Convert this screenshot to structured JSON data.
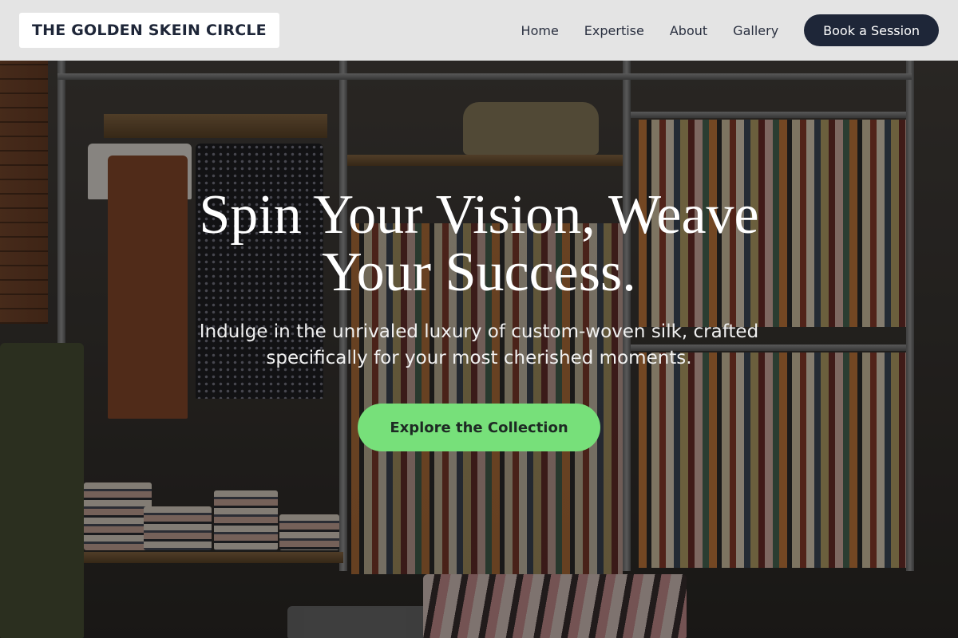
{
  "header": {
    "logo_text": "THE GOLDEN SKEIN CIRCLE",
    "nav": {
      "home": "Home",
      "expertise": "Expertise",
      "about": "About",
      "gallery": "Gallery"
    },
    "cta_label": "Book a Session"
  },
  "hero": {
    "title": "Spin Your Vision, Weave Your Success.",
    "subtitle": "Indulge in the unrivaled luxury of custom-woven silk, crafted specifically for your most cherished moments.",
    "button_label": "Explore the Collection"
  },
  "colors": {
    "header_bg": "#f0f0f0",
    "brand_dark": "#1e2638",
    "cta_green": "#77e07a",
    "hero_text": "#ffffff"
  }
}
